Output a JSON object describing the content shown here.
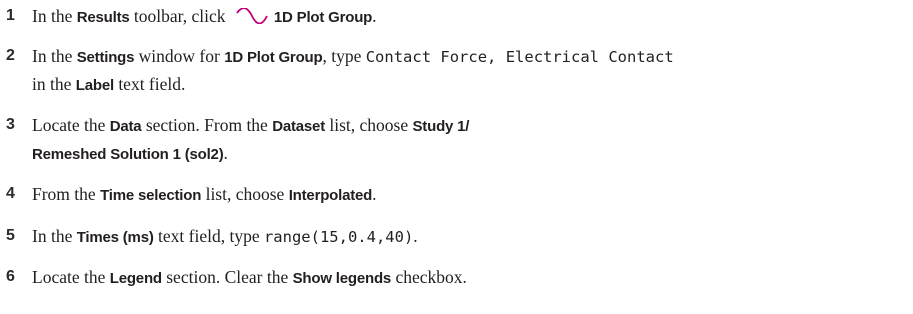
{
  "steps": [
    {
      "number": "1",
      "parts": {
        "t1": "In the ",
        "b1": "Results",
        "t2": " toolbar, click ",
        "icon": "sine-wave-plot-icon",
        "b2": "1D Plot Group",
        "t3": "."
      }
    },
    {
      "number": "2",
      "parts": {
        "t1": "In the ",
        "b1": "Settings",
        "t2": " window for ",
        "b2": "1D Plot Group",
        "t3": ", type ",
        "m1": "Contact Force, Electrical Contact",
        "line2_t1": "in the ",
        "line2_b1": "Label",
        "line2_t2": " text field."
      }
    },
    {
      "number": "3",
      "parts": {
        "t1": "Locate the ",
        "b1": "Data",
        "t2": " section. From the ",
        "b2": "Dataset",
        "t3": " list, choose ",
        "b3": "Study 1/",
        "line2_b1": "Remeshed Solution 1 (sol2)",
        "line2_t1": "."
      }
    },
    {
      "number": "4",
      "parts": {
        "t1": "From the ",
        "b1": "Time selection",
        "t2": " list, choose ",
        "b2": "Interpolated",
        "t3": "."
      }
    },
    {
      "number": "5",
      "parts": {
        "t1": "In the ",
        "b1": "Times (ms)",
        "t2": " text field, type ",
        "m1": "range(15,0.4,40)",
        "t3": "."
      }
    },
    {
      "number": "6",
      "parts": {
        "t1": "Locate the ",
        "b1": "Legend",
        "t2": " section. Clear the ",
        "b2": "Show legends",
        "t3": " checkbox."
      }
    }
  ],
  "colors": {
    "text": "#231f20",
    "icon": "#c2007a"
  }
}
